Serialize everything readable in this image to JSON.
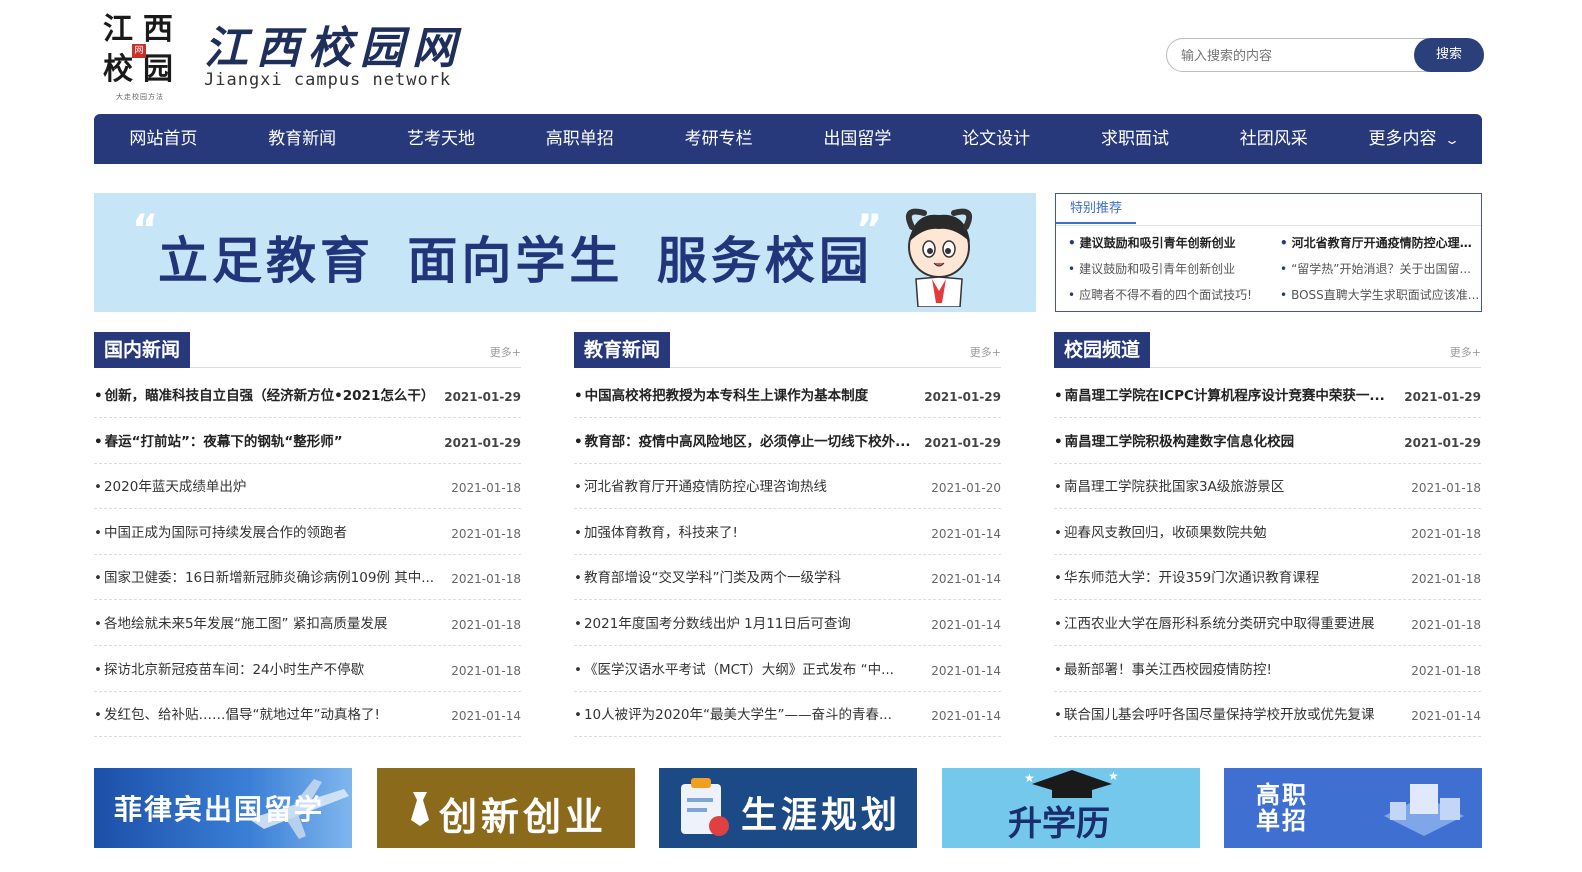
{
  "logo": {
    "seal_chars": [
      "江",
      "西",
      "校",
      "园"
    ],
    "seal_center": "网",
    "seal_tag": "大走校园方法",
    "title": "江西校园网",
    "subtitle": "Jiangxi campus network"
  },
  "search": {
    "placeholder": "输入搜索的内容",
    "button": "搜索"
  },
  "nav": {
    "items": [
      "网站首页",
      "教育新闻",
      "艺考天地",
      "高职单招",
      "考研专栏",
      "出国留学",
      "论文设计",
      "求职面试",
      "社团风采",
      "更多内容"
    ]
  },
  "banner": {
    "slogan": "立足教育  面向学生  服务校园"
  },
  "recommend": {
    "tab": "特别推荐",
    "left": [
      {
        "text": "建议鼓励和吸引青年创新创业",
        "bold": true
      },
      {
        "text": "建议鼓励和吸引青年创新创业",
        "bold": false
      },
      {
        "text": "应聘者不得不看的四个面试技巧!",
        "bold": false
      }
    ],
    "right": [
      {
        "text": "河北省教育厅开通疫情防控心理咨...",
        "bold": true
      },
      {
        "text": "“留学热”开始消退？关于出国留...",
        "bold": false
      },
      {
        "text": "BOSS直聘大学生求职面试应该准...",
        "bold": false
      }
    ]
  },
  "columns": [
    {
      "title": "国内新闻",
      "more": "更多+",
      "items": [
        {
          "title": "创新，瞄准科技自立自强（经济新方位•2021怎么干）",
          "date": "2021-01-29",
          "hot": true
        },
        {
          "title": "春运“打前站”：夜幕下的钢轨“整形师”",
          "date": "2021-01-29",
          "hot": true
        },
        {
          "title": "2020年蓝天成绩单出炉",
          "date": "2021-01-18",
          "hot": false
        },
        {
          "title": "中国正成为国际可持续发展合作的领跑者",
          "date": "2021-01-18",
          "hot": false
        },
        {
          "title": "国家卫健委：16日新增新冠肺炎确诊病例109例 其中...",
          "date": "2021-01-18",
          "hot": false
        },
        {
          "title": "各地绘就未来5年发展“施工图” 紧扣高质量发展",
          "date": "2021-01-18",
          "hot": false
        },
        {
          "title": "探访北京新冠疫苗车间：24小时生产不停歇",
          "date": "2021-01-18",
          "hot": false
        },
        {
          "title": "发红包、给补贴……倡导“就地过年”动真格了!",
          "date": "2021-01-14",
          "hot": false
        }
      ]
    },
    {
      "title": "教育新闻",
      "more": "更多+",
      "items": [
        {
          "title": "中国高校将把教授为本专科生上课作为基本制度",
          "date": "2021-01-29",
          "hot": true
        },
        {
          "title": "教育部：疫情中高风险地区，必须停止一切线下校外...",
          "date": "2021-01-29",
          "hot": true
        },
        {
          "title": "河北省教育厅开通疫情防控心理咨询热线",
          "date": "2021-01-20",
          "hot": false
        },
        {
          "title": "加强体育教育，科技来了!",
          "date": "2021-01-14",
          "hot": false
        },
        {
          "title": "教育部增设“交叉学科”门类及两个一级学科",
          "date": "2021-01-14",
          "hot": false
        },
        {
          "title": "2021年度国考分数线出炉 1月11日后可查询",
          "date": "2021-01-14",
          "hot": false
        },
        {
          "title": "《医学汉语水平考试（MCT）大纲》正式发布 “中...",
          "date": "2021-01-14",
          "hot": false
        },
        {
          "title": "10人被评为2020年“最美大学生”——奋斗的青春...",
          "date": "2021-01-14",
          "hot": false
        }
      ]
    },
    {
      "title": "校园频道",
      "more": "更多+",
      "items": [
        {
          "title": "南昌理工学院在ICPC计算机程序设计竞赛中荣获一...",
          "date": "2021-01-29",
          "hot": true
        },
        {
          "title": "南昌理工学院积极构建数字信息化校园",
          "date": "2021-01-29",
          "hot": true
        },
        {
          "title": "南昌理工学院获批国家3A级旅游景区",
          "date": "2021-01-18",
          "hot": false
        },
        {
          "title": "迎春风支教回归，收硕果数院共勉",
          "date": "2021-01-18",
          "hot": false
        },
        {
          "title": "华东师范大学：开设359门次通识教育课程",
          "date": "2021-01-18",
          "hot": false
        },
        {
          "title": "江西农业大学在唇形科系统分类研究中取得重要进展",
          "date": "2021-01-18",
          "hot": false
        },
        {
          "title": "最新部署！事关江西校园疫情防控!",
          "date": "2021-01-18",
          "hot": false
        },
        {
          "title": "联合国儿基会呼吁各国尽量保持学校开放或优先复课",
          "date": "2021-01-14",
          "hot": false
        }
      ]
    }
  ],
  "tiles": [
    "菲律宾出国留学",
    "创新创业",
    "生涯规划",
    "升学历",
    "高职单招"
  ],
  "colors": {
    "primary": "#27397a",
    "banner_bg": "#c6e6f7",
    "accent": "#3c6fc8"
  }
}
